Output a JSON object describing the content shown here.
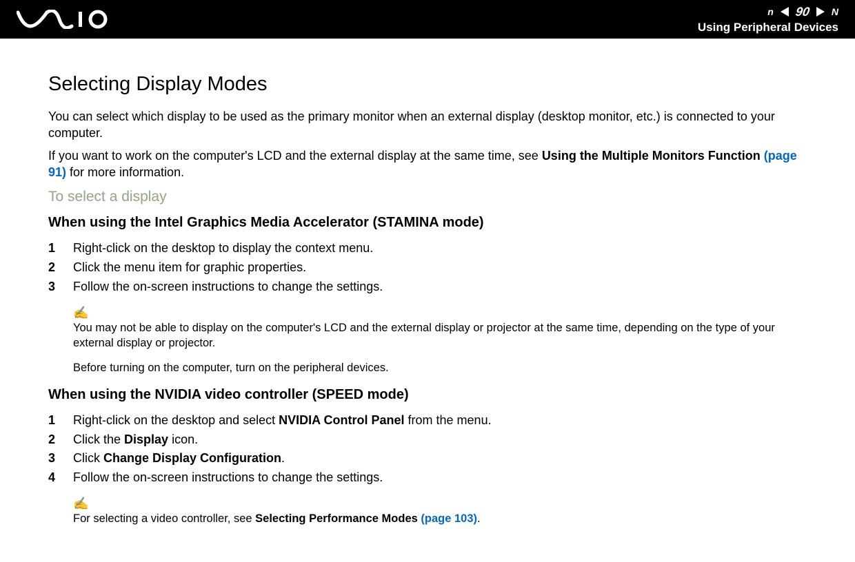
{
  "header": {
    "page_number": "90",
    "n_letter_left": "n",
    "n_letter_right": "N",
    "section_title": "Using Peripheral Devices"
  },
  "content": {
    "title": "Selecting Display Modes",
    "intro1": "You can select which display to be used as the primary monitor when an external display (desktop monitor, etc.) is connected to your computer.",
    "intro2_a": "If you want to work on the computer's LCD and the external display at the same time, see ",
    "intro2_bold": "Using the Multiple Monitors Function ",
    "intro2_link": "(page 91)",
    "intro2_c": " for more information.",
    "subheading": "To select a display",
    "mode1_title": "When using the Intel Graphics Media Accelerator (STAMINA mode)",
    "mode1_steps": [
      "Right-click on the desktop to display the context menu.",
      "Click the menu item for graphic properties.",
      "Follow the on-screen instructions to change the settings."
    ],
    "note_icon": "✍",
    "note1_text": "You may not be able to display on the computer's LCD and the external display or projector at the same time, depending on the type of your external display or projector.",
    "note1b_text": "Before turning on the computer, turn on the peripheral devices.",
    "mode2_title": "When using the NVIDIA video controller (SPEED mode)",
    "mode2_steps": {
      "s1_a": "Right-click on the desktop and select ",
      "s1_bold": "NVIDIA Control Panel",
      "s1_c": " from the menu.",
      "s2_a": "Click the ",
      "s2_bold": "Display",
      "s2_c": " icon.",
      "s3_a": "Click ",
      "s3_bold": "Change Display Configuration",
      "s3_c": ".",
      "s4": "Follow the on-screen instructions to change the settings."
    },
    "note2_a": "For selecting a video controller, see ",
    "note2_bold": "Selecting Performance Modes ",
    "note2_link": "(page 103)",
    "note2_c": "."
  }
}
